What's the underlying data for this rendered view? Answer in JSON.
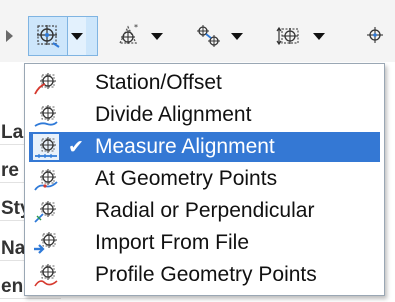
{
  "toolbar": {
    "buttons": [
      {
        "name": "create-point-tool",
        "icon": "point-crosshair-icon",
        "active": true
      },
      {
        "name": "points-from-file-tool",
        "icon": "point-new-icon",
        "active": false
      },
      {
        "name": "interpolate-points-tool",
        "icon": "point-interpolate-icon",
        "active": false
      },
      {
        "name": "slope-points-tool",
        "icon": "point-elevation-icon",
        "active": false
      },
      {
        "name": "more-point-tools",
        "icon": "point-settings-icon",
        "active": false
      }
    ]
  },
  "background_rows": [
    "La",
    "re",
    "Sty",
    "Na",
    "en"
  ],
  "menu": {
    "items": [
      {
        "label": "Station/Offset",
        "icon": "station-offset-icon",
        "selected": false
      },
      {
        "label": "Divide Alignment",
        "icon": "divide-alignment-icon",
        "selected": false
      },
      {
        "label": "Measure Alignment",
        "icon": "measure-alignment-icon",
        "selected": true,
        "check": "✔"
      },
      {
        "label": "At Geometry Points",
        "icon": "geometry-points-icon",
        "selected": false
      },
      {
        "label": "Radial or Perpendicular",
        "icon": "radial-perpendicular-icon",
        "selected": false
      },
      {
        "label": "Import From File",
        "icon": "import-file-icon",
        "selected": false
      },
      {
        "label": "Profile Geometry Points",
        "icon": "profile-geometry-icon",
        "selected": false
      }
    ]
  },
  "colors": {
    "selected_bg": "#3478d4",
    "accent_blue": "#2f7ad8",
    "accent_red": "#d63a2f",
    "accent_green": "#2b9a4a"
  }
}
